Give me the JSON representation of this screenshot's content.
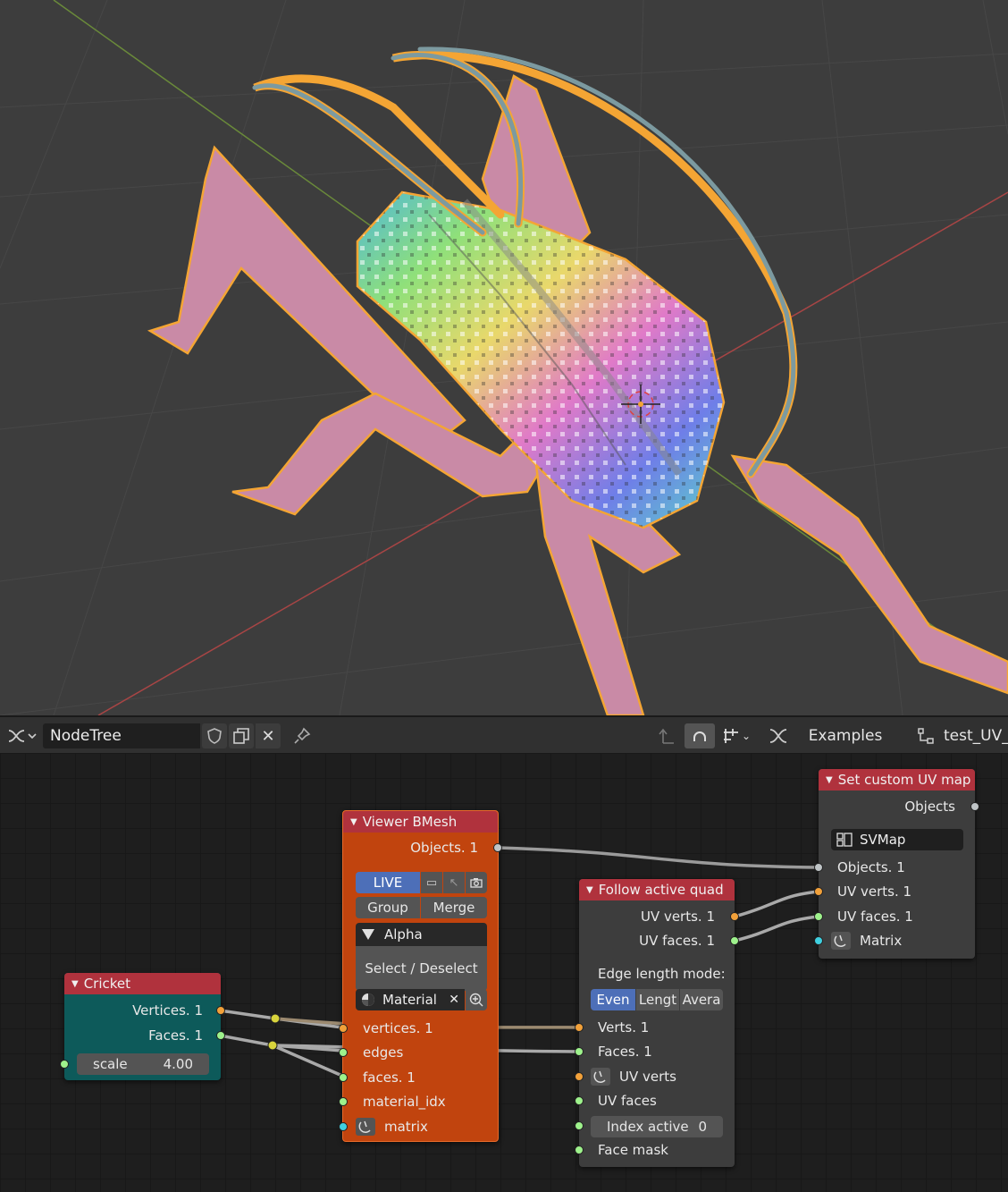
{
  "header": {
    "tree_name": "NodeTree",
    "examples_label": "Examples",
    "tree_label": "test_UV_"
  },
  "nodes": {
    "cricket": {
      "title": "Cricket",
      "outputs": [
        "Vertices. 1",
        "Faces. 1"
      ],
      "scale_label": "scale",
      "scale_value": "4.00"
    },
    "viewer": {
      "title": "Viewer BMesh",
      "output": "Objects. 1",
      "live_label": "LIVE",
      "group_label": "Group",
      "merge_label": "Merge",
      "alpha_label": "Alpha",
      "select_label": "Select / Deselect",
      "material_label": "Material",
      "inputs": [
        "vertices. 1",
        "edges",
        "faces. 1",
        "material_idx",
        "matrix"
      ]
    },
    "follow": {
      "title": "Follow active quad",
      "outputs": [
        "UV verts. 1",
        "UV faces. 1"
      ],
      "mode_label": "Edge length mode:",
      "modes": [
        "Even",
        "Lengt",
        "Avera"
      ],
      "inputs": [
        "Verts. 1",
        "Faces. 1",
        "UV verts",
        "UV faces",
        "Face mask"
      ],
      "index_label": "Index active",
      "index_value": "0"
    },
    "setuv": {
      "title": "Set custom UV map",
      "output": "Objects",
      "map_name": "SVMap",
      "inputs": [
        "Objects. 1",
        "UV verts. 1",
        "UV faces. 1",
        "Matrix"
      ]
    }
  },
  "colors": {
    "viewport_bg": "#3d3d3d",
    "node_red": "#b0323d",
    "viewer_body": "#c1440e",
    "cricket_body": "#0d5a5a",
    "selected_outline": "#f4a534",
    "active_blue": "#4d6fb8"
  }
}
